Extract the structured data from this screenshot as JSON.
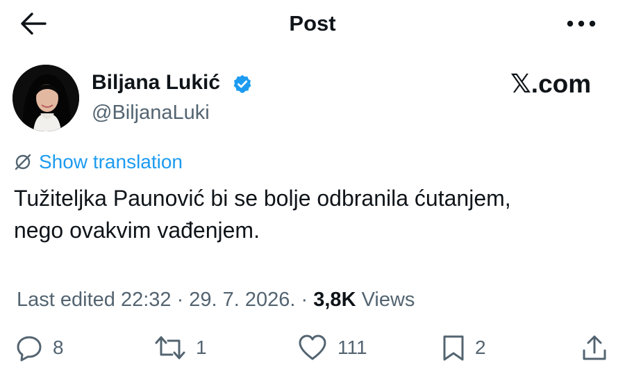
{
  "header": {
    "title": "Post"
  },
  "author": {
    "name": "Biljana Lukić",
    "handle": "@BiljanaLuki",
    "verified_color": "#1d9bf0"
  },
  "watermark": "𝕏.com",
  "translation": {
    "label": "Show translation",
    "color": "#1d9bf0"
  },
  "post": {
    "text_line1": "Tužiteljka Paunović bi se bolje odbranila ćutanjem,",
    "text_line2": "nego ovakvim vađenjem."
  },
  "meta": {
    "edited": "Last edited 22:32 · 29. 7. 2026.",
    "separator": " · ",
    "views_count": "3,8K",
    "views_label": " Views"
  },
  "actions": {
    "replies": "8",
    "reposts": "1",
    "likes": "111",
    "bookmarks": "2"
  },
  "icons": {
    "back": "arrow-left-icon",
    "more": "more-dots-icon",
    "verified": "verified-badge-icon",
    "translate": "translate-icon",
    "reply": "reply-icon",
    "repost": "repost-icon",
    "like": "heart-icon",
    "bookmark": "bookmark-icon",
    "share": "share-icon"
  }
}
